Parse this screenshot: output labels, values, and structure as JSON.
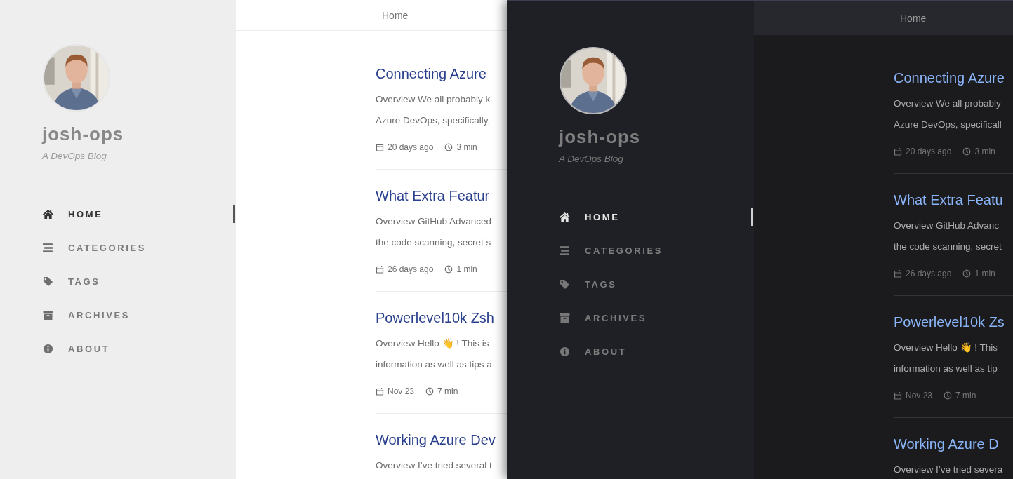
{
  "windows": [
    {
      "kind": "light",
      "topbar": {
        "title": "Home"
      },
      "sidebar": {
        "title": "josh-ops",
        "subtitle": "A DevOps Blog",
        "nav": [
          {
            "kind": "home",
            "label": "HOME",
            "selected": true
          },
          {
            "kind": "categories",
            "label": "CATEGORIES",
            "selected": false
          },
          {
            "kind": "tags",
            "label": "TAGS",
            "selected": false
          },
          {
            "kind": "archives",
            "label": "ARCHIVES",
            "selected": false
          },
          {
            "kind": "about",
            "label": "ABOUT",
            "selected": false
          }
        ]
      },
      "posts": [
        {
          "title": "Connecting Azure",
          "excerpt": [
            "Overview We all probably k",
            "Azure DevOps, specifically,"
          ],
          "date": "20 days ago",
          "read_time": "3 min"
        },
        {
          "title": "What Extra Featur",
          "excerpt": [
            "Overview GitHub Advanced",
            "the code scanning, secret s"
          ],
          "date": "26 days ago",
          "read_time": "1 min"
        },
        {
          "title": "Powerlevel10k Zsh",
          "excerpt": [
            "Overview Hello 👋 ! This is",
            "information as well as tips a"
          ],
          "date": "Nov 23",
          "read_time": "7 min"
        },
        {
          "title": "Working Azure Dev",
          "excerpt": [
            "Overview I’ve tried several t"
          ]
        }
      ]
    },
    {
      "kind": "dark",
      "topbar": {
        "title": "Home"
      },
      "sidebar": {
        "title": "josh-ops",
        "subtitle": "A DevOps Blog",
        "nav": [
          {
            "kind": "home",
            "label": "HOME",
            "selected": true
          },
          {
            "kind": "categories",
            "label": "CATEGORIES",
            "selected": false
          },
          {
            "kind": "tags",
            "label": "TAGS",
            "selected": false
          },
          {
            "kind": "archives",
            "label": "ARCHIVES",
            "selected": false
          },
          {
            "kind": "about",
            "label": "ABOUT",
            "selected": false
          }
        ]
      },
      "posts": [
        {
          "title": "Connecting Azure",
          "excerpt": [
            "Overview We all probably",
            "Azure DevOps, specificall"
          ],
          "date": "20 days ago",
          "read_time": "3 min"
        },
        {
          "title": "What Extra Featu",
          "excerpt": [
            "Overview GitHub Advanc",
            "the code scanning, secret"
          ],
          "date": "26 days ago",
          "read_time": "1 min"
        },
        {
          "title": "Powerlevel10k Zs",
          "excerpt": [
            "Overview Hello 👋 ! This",
            "information as well as tip"
          ],
          "date": "Nov 23",
          "read_time": "7 min"
        },
        {
          "title": "Working Azure D",
          "excerpt": [
            "Overview I’ve tried severa"
          ]
        }
      ]
    }
  ]
}
